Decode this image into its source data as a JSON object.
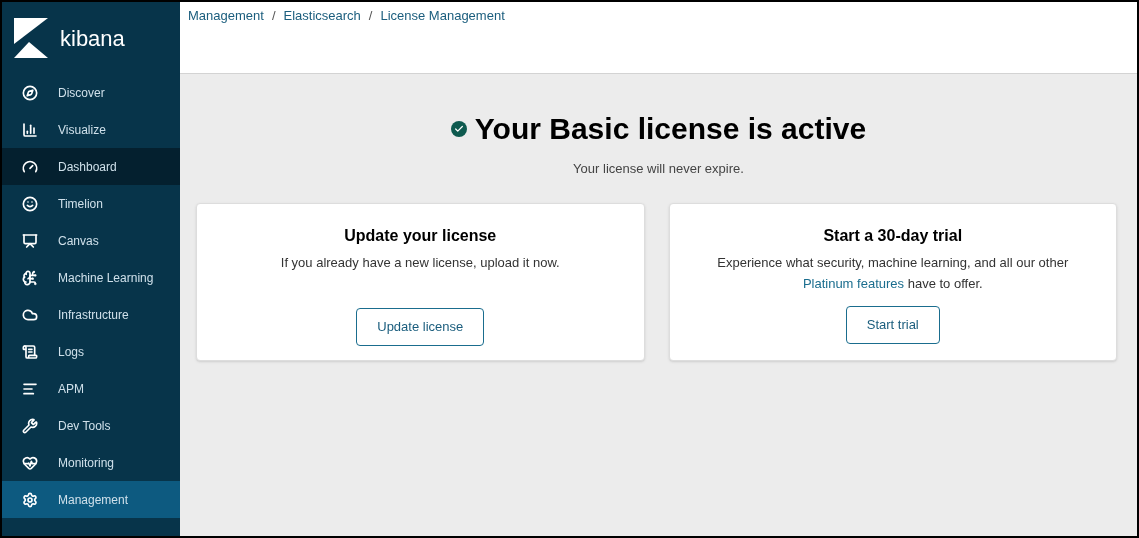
{
  "sidebar": {
    "logo_text": "kibana",
    "items": [
      {
        "label": "Discover",
        "selected": false,
        "hovered": false
      },
      {
        "label": "Visualize",
        "selected": false,
        "hovered": false
      },
      {
        "label": "Dashboard",
        "selected": false,
        "hovered": true
      },
      {
        "label": "Timelion",
        "selected": false,
        "hovered": false
      },
      {
        "label": "Canvas",
        "selected": false,
        "hovered": false
      },
      {
        "label": "Machine Learning",
        "selected": false,
        "hovered": false
      },
      {
        "label": "Infrastructure",
        "selected": false,
        "hovered": false
      },
      {
        "label": "Logs",
        "selected": false,
        "hovered": false
      },
      {
        "label": "APM",
        "selected": false,
        "hovered": false
      },
      {
        "label": "Dev Tools",
        "selected": false,
        "hovered": false
      },
      {
        "label": "Monitoring",
        "selected": false,
        "hovered": false
      },
      {
        "label": "Management",
        "selected": true,
        "hovered": false
      }
    ]
  },
  "breadcrumbs": [
    "Management",
    "Elasticsearch",
    "License Management"
  ],
  "breadcrumb_separator": "/",
  "status": {
    "title": "Your Basic license is active",
    "subtitle": "Your license will never expire."
  },
  "cards": [
    {
      "title": "Update your license",
      "text": "If you already have a new license, upload it now.",
      "button": "Update license"
    },
    {
      "title": "Start a 30-day trial",
      "text": "Experience what security, machine learning, and all our other",
      "link": "Platinum features",
      "text_after": "have to offer.",
      "button": "Start trial"
    }
  ]
}
